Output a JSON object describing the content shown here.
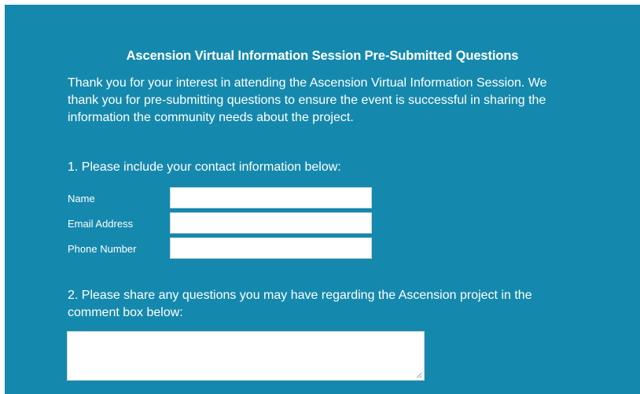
{
  "form": {
    "title": "Ascension Virtual Information Session Pre-Submitted Questions",
    "intro": "Thank you for your interest in attending the Ascension Virtual Information Session. We thank you for pre-submitting questions to ensure the event is successful in sharing the information the community needs about the project.",
    "question1": {
      "label": "1. Please include your contact information below:",
      "fields": [
        {
          "label": "Name",
          "value": ""
        },
        {
          "label": "Email Address",
          "value": ""
        },
        {
          "label": "Phone Number",
          "value": ""
        }
      ]
    },
    "question2": {
      "label": "2. Please share any questions you may have regarding the Ascension project in the comment box below:",
      "value": ""
    }
  },
  "colors": {
    "background": "#1589ad",
    "text": "#ffffff",
    "input": "#ffffff"
  },
  "icons": {
    "textarea_resize": "resize-grip-icon"
  }
}
